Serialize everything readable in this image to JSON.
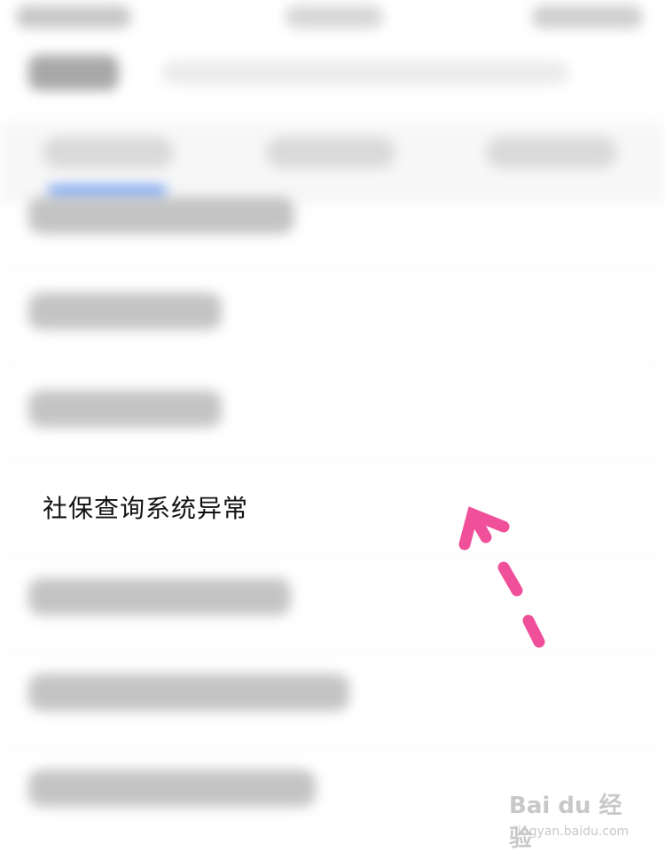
{
  "list": {
    "highlighted_item": "社保查询系统异常"
  },
  "annotation": {
    "arrow_color": "#f0509a"
  },
  "watermark": {
    "logo": "Bai du 经验",
    "url": "jingyan.baidu.com"
  },
  "colors": {
    "tab_indicator": "#4a86f5",
    "background": "#ffffff"
  }
}
